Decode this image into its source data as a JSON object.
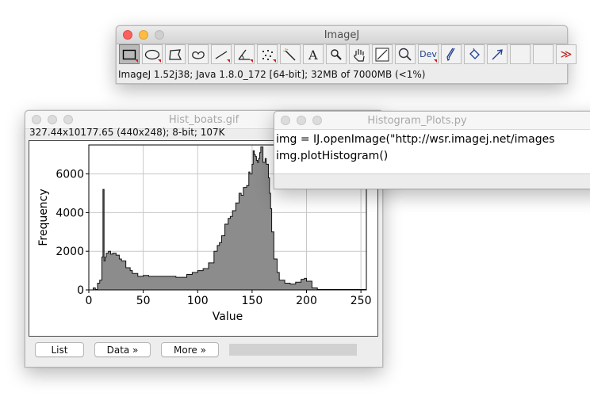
{
  "imagej": {
    "title": "ImageJ",
    "status": "ImageJ 1.52j38; Java 1.8.0_172 [64-bit]; 32MB of 7000MB (<1%)",
    "dev_label": "Dev",
    "more_label": "≫",
    "tools": [
      "rectangle-tool-icon",
      "oval-tool-icon",
      "polygon-tool-icon",
      "freehand-tool-icon",
      "line-tool-icon",
      "angle-tool-icon",
      "point-tool-icon",
      "wand-tool-icon",
      "text-tool-icon",
      "magnifier-tool-icon",
      "hand-tool-icon",
      "color-picker-tool-icon",
      "zoom-tool-icon",
      "dev-tool-icon",
      "brush-tool-icon",
      "flood-fill-tool-icon",
      "arrow-tool-icon",
      "blank-slot",
      "blank-slot",
      "more-tools-icon"
    ]
  },
  "histogram_window": {
    "title": "Hist_boats.gif",
    "info": "327.44x10177.65   (440x248); 8-bit; 107K",
    "buttons": {
      "list": "List",
      "data": "Data »",
      "more": "More »"
    }
  },
  "script_window": {
    "title": "Histogram_Plots.py",
    "line1": "img = IJ.openImage(\"http://wsr.imagej.net/images",
    "line2": "img.plotHistogram()"
  },
  "chart_data": {
    "type": "area",
    "xlabel": "Value",
    "ylabel": "Frequency",
    "xlim": [
      0,
      255
    ],
    "ylim": [
      0,
      7500
    ],
    "x_ticks": [
      0,
      50,
      100,
      150,
      200,
      250
    ],
    "y_ticks": [
      0,
      2000,
      4000,
      6000
    ],
    "grid": true,
    "color": "#8c8c8c",
    "x": [
      0,
      4,
      6,
      8,
      10,
      12,
      13,
      14,
      15,
      16,
      18,
      20,
      22,
      25,
      28,
      30,
      34,
      38,
      40,
      45,
      50,
      55,
      60,
      70,
      80,
      90,
      95,
      100,
      105,
      110,
      115,
      118,
      120,
      122,
      125,
      128,
      130,
      132,
      135,
      138,
      140,
      142,
      145,
      147,
      148,
      150,
      151,
      152,
      153,
      154,
      155,
      156,
      157,
      158,
      160,
      162,
      163,
      165,
      166,
      167,
      168,
      170,
      173,
      175,
      180,
      185,
      190,
      195,
      198,
      200,
      205,
      210,
      255
    ],
    "y": [
      0,
      100,
      20,
      350,
      500,
      1700,
      5200,
      1500,
      1700,
      1900,
      2000,
      1850,
      1900,
      1800,
      1600,
      1500,
      1150,
      1000,
      850,
      700,
      750,
      700,
      700,
      700,
      650,
      800,
      900,
      1000,
      1100,
      1400,
      2000,
      2300,
      2450,
      2800,
      3400,
      3700,
      3800,
      4100,
      4500,
      5000,
      4900,
      5300,
      5400,
      6100,
      6000,
      6500,
      7200,
      7000,
      6900,
      6700,
      6600,
      6800,
      7100,
      7400,
      6600,
      6800,
      6500,
      5800,
      5000,
      4200,
      3000,
      1600,
      900,
      500,
      350,
      300,
      400,
      550,
      600,
      450,
      100,
      20,
      0
    ]
  }
}
